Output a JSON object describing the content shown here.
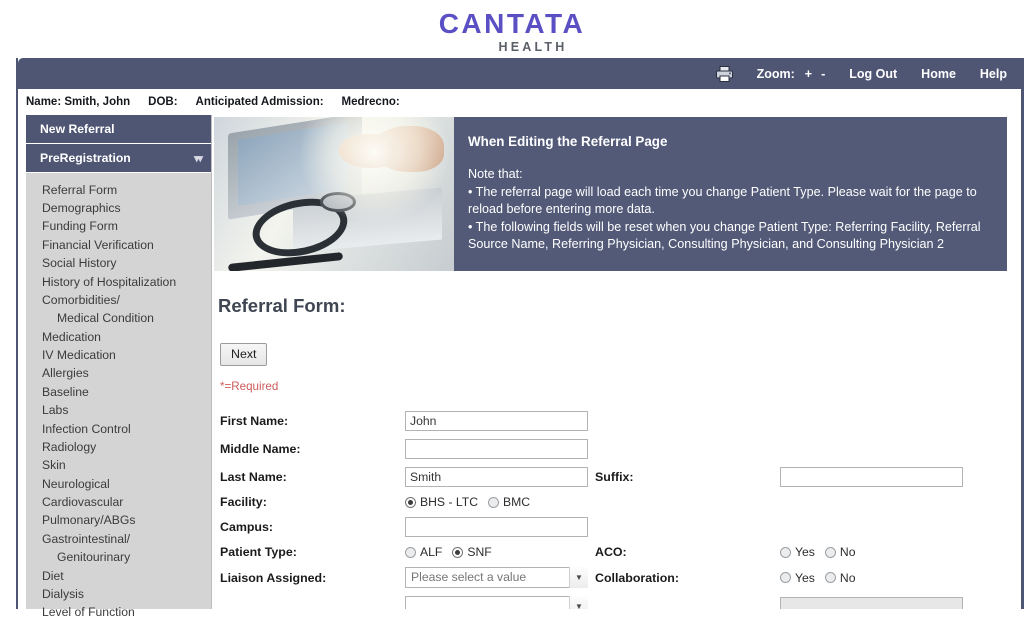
{
  "brand": {
    "name": "CANTATA",
    "sub": "HEALTH",
    "purple": "#5b4fc4",
    "gray": "#5a5f68"
  },
  "topnav": {
    "printer_icon": "printer-icon",
    "zoom_label": "Zoom:",
    "zoom_in": "+",
    "zoom_out": "-",
    "logout": "Log Out",
    "home": "Home",
    "help": "Help",
    "bg": "#4f5674"
  },
  "patient_bar": {
    "name_label": "Name: Smith, John",
    "dob_label": "DOB:",
    "admission_label": "Anticipated Admission:",
    "medrecno_label": "Medrecno:"
  },
  "sidebar": {
    "new_referral": "New Referral",
    "preregistration": "PreRegistration",
    "collapse_icon": "chevron-double-down-icon",
    "items": [
      {
        "label": "Referral Form",
        "indent": false
      },
      {
        "label": "Demographics",
        "indent": false
      },
      {
        "label": "Funding Form",
        "indent": false
      },
      {
        "label": "Financial Verification",
        "indent": false
      },
      {
        "label": "Social History",
        "indent": false
      },
      {
        "label": "History of Hospitalization",
        "indent": false
      },
      {
        "label": "Comorbidities/",
        "indent": false
      },
      {
        "label": "Medical Condition",
        "indent": true
      },
      {
        "label": "Medication",
        "indent": false
      },
      {
        "label": "IV Medication",
        "indent": false
      },
      {
        "label": "Allergies",
        "indent": false
      },
      {
        "label": "Baseline",
        "indent": false
      },
      {
        "label": "Labs",
        "indent": false
      },
      {
        "label": "Infection Control",
        "indent": false
      },
      {
        "label": "Radiology",
        "indent": false
      },
      {
        "label": "Skin",
        "indent": false
      },
      {
        "label": "Neurological",
        "indent": false
      },
      {
        "label": "Cardiovascular",
        "indent": false
      },
      {
        "label": "Pulmonary/ABGs",
        "indent": false
      },
      {
        "label": "Gastrointestinal/",
        "indent": false
      },
      {
        "label": "Genitourinary",
        "indent": true
      },
      {
        "label": "Diet",
        "indent": false
      },
      {
        "label": "Dialysis",
        "indent": false
      },
      {
        "label": "Level of Function",
        "indent": false
      }
    ]
  },
  "banner": {
    "photo_alt": "laptop-stethoscope-photo",
    "title": "When Editing the Referral Page",
    "note_intro": "Note that:",
    "bullet1": "•   The referral page will load each time you change Patient Type. Please wait for the page to reload before entering more data.",
    "bullet2": "•   The following fields will be reset when you change Patient Type: Referring Facility, Referral Source Name, Referring Physician, Consulting Physician, and Consulting Physician 2",
    "bg": "#525a78"
  },
  "form": {
    "title": "Referral Form:",
    "next_button": "Next",
    "required_note": "*=Required",
    "required_color": "#cc5c5c",
    "first_name": {
      "label": "First Name:",
      "value": "John"
    },
    "middle_name": {
      "label": "Middle Name:",
      "value": ""
    },
    "last_name": {
      "label": "Last Name:",
      "value": "Smith"
    },
    "suffix": {
      "label": "Suffix:",
      "value": ""
    },
    "facility": {
      "label": "Facility:",
      "options": [
        "BHS - LTC",
        "BMC"
      ],
      "selected": "BHS - LTC"
    },
    "campus": {
      "label": "Campus:",
      "value": ""
    },
    "patient_type": {
      "label": "Patient Type:",
      "options": [
        "ALF",
        "SNF"
      ],
      "selected": "SNF"
    },
    "aco": {
      "label": "ACO:",
      "options": [
        "Yes",
        "No"
      ],
      "selected": ""
    },
    "liaison": {
      "label": "Liaison Assigned:",
      "value": "Please select a value",
      "arrow_icon": "chevron-down-icon"
    },
    "collaboration": {
      "label": "Collaboration:",
      "options": [
        "Yes",
        "No"
      ],
      "selected": ""
    }
  }
}
